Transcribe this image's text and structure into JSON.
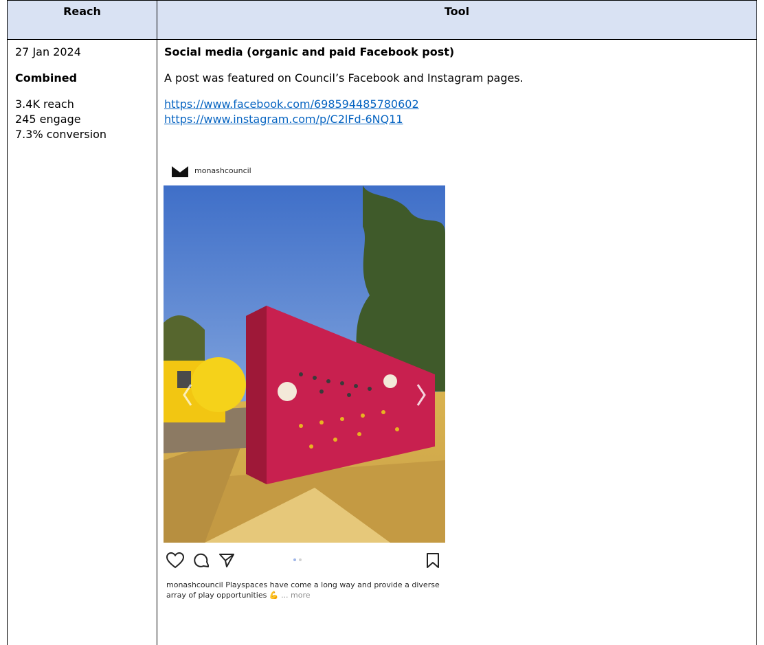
{
  "table": {
    "header_reach": "Reach",
    "header_tool": "Tool"
  },
  "reach": {
    "date": "27 Jan 2024",
    "combined_label": "Combined",
    "reach_line": "3.4K reach",
    "engage_line": "245 engage",
    "conversion_line": "7.3% conversion"
  },
  "tool": {
    "title": "Social media (organic and paid Facebook post)",
    "description": "A post was featured on Council’s Facebook and Instagram pages.",
    "facebook_link": "https://www.facebook.com/698594485780602",
    "instagram_link": "https://www.instagram.com/p/C2lFd-6NQ11"
  },
  "instagram_post": {
    "username": "monashcouncil",
    "caption_user": "monashcouncil",
    "caption_text": " Playspaces have come a long way and provide a diverse array of play opportunities",
    "caption_more": "... more",
    "icons": [
      "heart-icon",
      "comment-icon",
      "share-icon",
      "carousel-dots-icon",
      "bookmark-icon",
      "chevron-left-icon",
      "chevron-right-icon"
    ]
  }
}
